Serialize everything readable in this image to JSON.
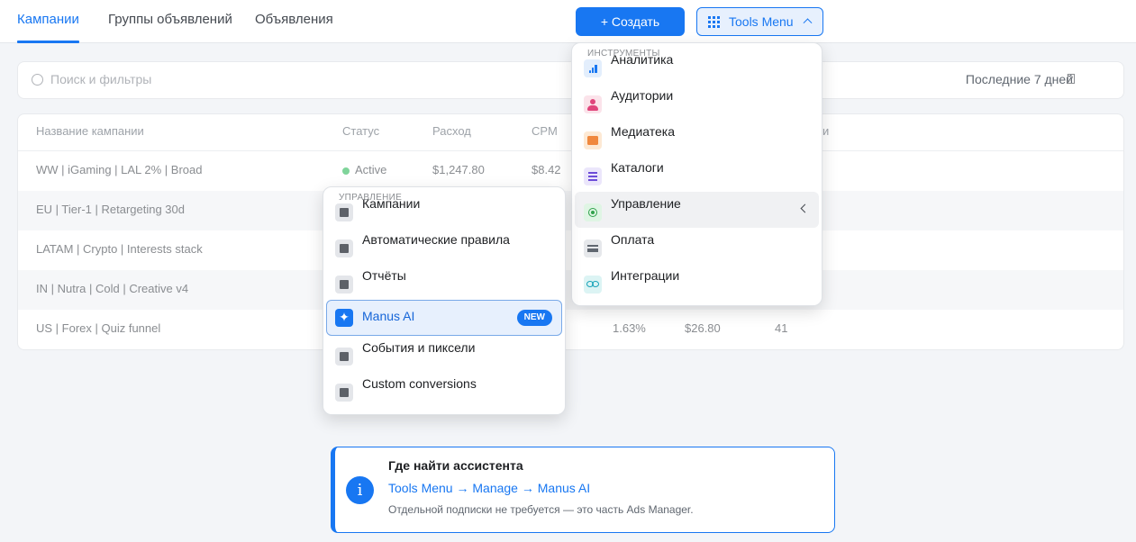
{
  "tabs": [
    {
      "label": "Кампании",
      "active": true
    },
    {
      "label": "Группы объявлений",
      "active": false
    },
    {
      "label": "Объявления",
      "active": false
    }
  ],
  "create_button": {
    "label": "+ Создать"
  },
  "tools_button": {
    "label": "Tools Menu"
  },
  "search": {
    "placeholder": "Поиск и фильтры",
    "date_range": "Последние 7 дней"
  },
  "table": {
    "headers": [
      "Название кампании",
      "Статус",
      "Расход",
      "CPM",
      "и"
    ],
    "rows": [
      {
        "name": "WW | iGaming | LAL 2% | Broad",
        "status": "Active",
        "spend": "$1,247.80",
        "cpm": "$8.42",
        "c5": "",
        "c6": "",
        "c7": ""
      },
      {
        "name": "EU | Tier-1 | Retargeting 30d",
        "status": "",
        "spend": "",
        "cpm": "",
        "c5": "",
        "c6": "",
        "c7": ""
      },
      {
        "name": "LATAM | Crypto | Interests stack",
        "status": "",
        "spend": "",
        "cpm": "",
        "c5": "",
        "c6": "",
        "c7": ""
      },
      {
        "name": "IN | Nutra | Cold | Creative v4",
        "status": "",
        "spend": "",
        "cpm": "",
        "c5": "",
        "c6": "",
        "c7": ""
      },
      {
        "name": "US | Forex | Quiz funnel",
        "status": "",
        "spend": "",
        "cpm": "",
        "c5": "1.63%",
        "c6": "$26.80",
        "c7": "41"
      }
    ]
  },
  "tools_menu": {
    "heading": "ИНСТРУМЕНТЫ",
    "items": [
      {
        "label": "Аналитика",
        "icon": "analytics-icon"
      },
      {
        "label": "Аудитории",
        "icon": "audience-icon"
      },
      {
        "label": "Медиатека",
        "icon": "media-library-icon"
      },
      {
        "label": "Каталоги",
        "icon": "catalog-icon"
      },
      {
        "label": "Управление",
        "icon": "manage-icon"
      },
      {
        "label": "Оплата",
        "icon": "payment-icon"
      },
      {
        "label": "Интеграции",
        "icon": "integrations-icon"
      }
    ]
  },
  "manage_menu": {
    "heading": "УПРАВЛЕНИЕ",
    "items": [
      {
        "label": "Кампании"
      },
      {
        "label": "Автоматические правила"
      },
      {
        "label": "Отчёты"
      },
      {
        "label": "Manus AI",
        "badge": "NEW"
      },
      {
        "label": "События и пиксели"
      },
      {
        "label": "Custom conversions"
      }
    ]
  },
  "info_card": {
    "icon": "i",
    "title": "Где найти ассистента",
    "path": "Tools Menu → Manage → Manus AI",
    "note": "Отдельной подписки не требуется — это часть Ads Manager."
  },
  "colors": {
    "accent": "#1877f2",
    "active_status": "#7fd49a"
  }
}
